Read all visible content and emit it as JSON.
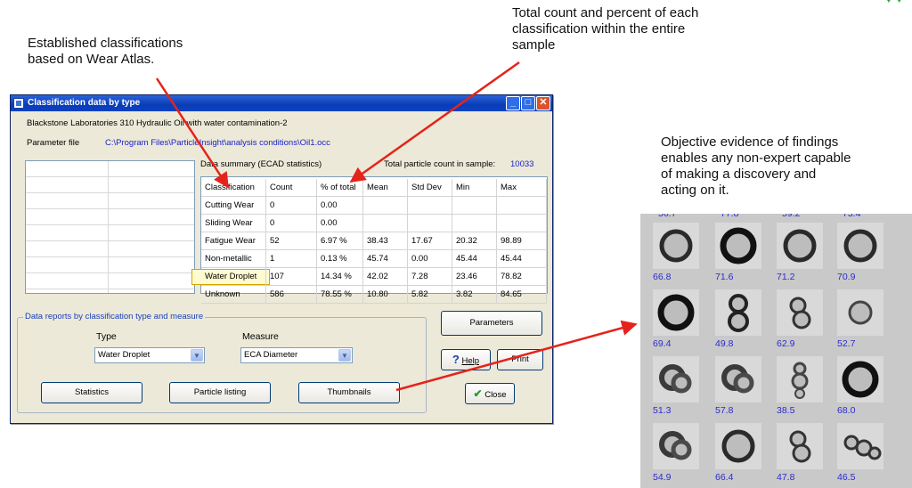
{
  "annotations": {
    "left": [
      "Established classifications",
      "based on Wear Atlas."
    ],
    "top": [
      "Total count and percent of each",
      "classification within the entire",
      "sample"
    ],
    "right": [
      "Objective evidence of findings",
      "enables any non-expert capable",
      "of making a discovery and",
      "acting on it."
    ]
  },
  "window": {
    "title": "Classification data by type",
    "sample_name": "Blackstone Laboratories  310 Hydraulic Oil with water contamination-2",
    "parameter_label": "Parameter file",
    "parameter_path": "C:\\Program Files\\ParticleInsight\\analysis conditions\\Oil1.occ",
    "summary_label": "Data summary  (ECAD statistics)",
    "total_label": "Total particle count in sample:",
    "total_value": "10033",
    "colors": {
      "titlebar": "#0a3cb6",
      "link": "#1a22c8",
      "selected_border": "#d4a600"
    }
  },
  "table": {
    "headers": [
      "Classification",
      "Count",
      "% of total",
      "Mean",
      "Std Dev",
      "Min",
      "Max"
    ],
    "rows": [
      [
        "Cutting Wear",
        "0",
        "0.00",
        "",
        "",
        "",
        ""
      ],
      [
        "Sliding Wear",
        "0",
        "0.00",
        "",
        "",
        "",
        ""
      ],
      [
        "Fatigue Wear",
        "52",
        "6.97 %",
        "38.43",
        "17.67",
        "20.32",
        "98.89"
      ],
      [
        "Non-metallic",
        "1",
        "0.13 %",
        "45.74",
        "0.00",
        "45.44",
        "45.44"
      ],
      [
        "Water Droplet",
        "107",
        "14.34 %",
        "42.02",
        "7.28",
        "23.46",
        "78.82"
      ],
      [
        "Unknown",
        "586",
        "78.55 %",
        "10.80",
        "5.82",
        "3.82",
        "84.65"
      ]
    ],
    "selected_row": "Water Droplet"
  },
  "reports": {
    "group_label": "Data reports by classification type and measure",
    "type_label": "Type",
    "type_value": "Water Droplet",
    "measure_label": "Measure",
    "measure_value": "ECA Diameter",
    "statistics_button": "Statistics",
    "particle_listing_button": "Particle listing",
    "thumbnails_button": "Thumbnails"
  },
  "side_buttons": {
    "parameters": "Parameters",
    "help": "Help",
    "print": "Print",
    "close": "Close"
  },
  "thumbnails": {
    "top_row_partial": [
      "56.7",
      "77.8",
      "59.2",
      "73.4"
    ],
    "values": [
      [
        "66.8",
        "71.6",
        "71.2",
        "70.9"
      ],
      [
        "69.4",
        "49.8",
        "62.9",
        "52.7"
      ],
      [
        "51.3",
        "57.8",
        "38.5",
        "68.0"
      ],
      [
        "54.9",
        "66.4",
        "47.8",
        "46.5"
      ]
    ],
    "icons": [
      "droplet-ring-icon",
      "double-droplet-icon",
      "clustered-droplet-icon"
    ],
    "value_color": "#2b2bd0"
  }
}
